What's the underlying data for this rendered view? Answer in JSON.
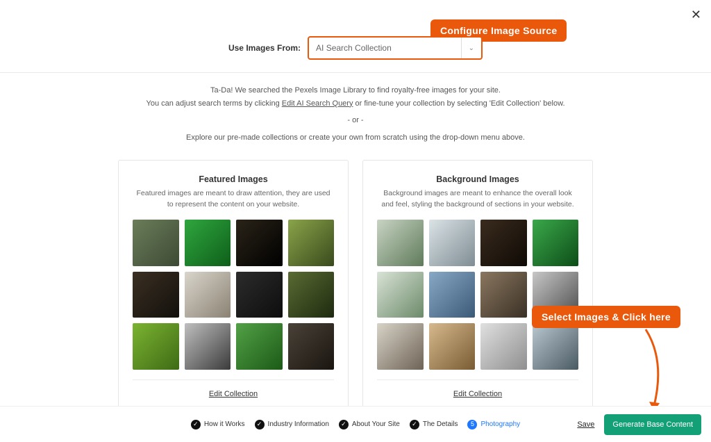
{
  "close_icon": "✕",
  "source": {
    "label": "Use Images From:",
    "selected": "AI Search Collection"
  },
  "callouts": {
    "top": "Configure Image Source",
    "right": "Select Images & Click here"
  },
  "intro": {
    "line1": "Ta-Da! We searched the Pexels Image Library to find royalty-free images for your site.",
    "line2_pre": "You can adjust search terms by clicking ",
    "line2_link": "Edit AI Search Query",
    "line2_post": " or fine-tune your collection by selecting 'Edit Collection' below.",
    "or": "- or -",
    "line3": "Explore our pre-made collections or create your own from scratch using the drop-down menu above."
  },
  "featured": {
    "title": "Featured Images",
    "desc": "Featured images are meant to draw attention, they are used to represent the content on your website.",
    "edit": "Edit Collection",
    "thumbs": [
      {
        "name": "bird-branch",
        "bg": "linear-gradient(135deg,#6b7d5a,#3d4a34)"
      },
      {
        "name": "leaf-macro",
        "bg": "linear-gradient(135deg,#2fa63e,#0e5f1a)"
      },
      {
        "name": "dark-woods",
        "bg": "linear-gradient(135deg,#2a2318,#000)"
      },
      {
        "name": "moss-log",
        "bg": "linear-gradient(135deg,#8aa44a,#394a1c)"
      },
      {
        "name": "fox-night",
        "bg": "linear-gradient(135deg,#3b2f22,#12100c)"
      },
      {
        "name": "hand-camera",
        "bg": "linear-gradient(135deg,#d9d5cc,#8b8273)"
      },
      {
        "name": "laptop-desk",
        "bg": "linear-gradient(135deg,#2c2c2c,#0d0d0d)"
      },
      {
        "name": "camera-grass",
        "bg": "linear-gradient(135deg,#5a6b32,#1e2a10)"
      },
      {
        "name": "caterpillar",
        "bg": "linear-gradient(135deg,#7bb431,#3e6a15)"
      },
      {
        "name": "camera-bw",
        "bg": "linear-gradient(135deg,#bfbfbf,#3b3b3b)"
      },
      {
        "name": "green-plant",
        "bg": "linear-gradient(135deg,#52a146,#1c5a17)"
      },
      {
        "name": "dslr-hold",
        "bg": "linear-gradient(135deg,#4a4238,#1a1510)"
      }
    ]
  },
  "background": {
    "title": "Background Images",
    "desc": "Background images are meant to enhance the overall look and feel, styling the background of sections in your website.",
    "edit": "Edit Collection",
    "thumbs": [
      {
        "name": "photog-outdoor",
        "bg": "linear-gradient(135deg,#c8d4c3,#5f7a5a)"
      },
      {
        "name": "photog-look",
        "bg": "linear-gradient(135deg,#dbe3e6,#7f8d94)"
      },
      {
        "name": "cattle-dark",
        "bg": "linear-gradient(135deg,#3a2b1e,#0f0a05)"
      },
      {
        "name": "fern-green",
        "bg": "linear-gradient(135deg,#3aa84a,#0d4d18)"
      },
      {
        "name": "stork-water",
        "bg": "linear-gradient(135deg,#d9e3d6,#6c8a6a)"
      },
      {
        "name": "boy-camera",
        "bg": "linear-gradient(135deg,#88a9c6,#3b5a78)"
      },
      {
        "name": "man-shoot",
        "bg": "linear-gradient(135deg,#8a7760,#3a3025)"
      },
      {
        "name": "hikers-bw",
        "bg": "linear-gradient(135deg,#c7c7c7,#4d4d4d)"
      },
      {
        "name": "back-shoot",
        "bg": "linear-gradient(135deg,#d8d3c8,#6e6355)"
      },
      {
        "name": "camera-flat",
        "bg": "linear-gradient(135deg,#d6b98c,#7a5c34)"
      },
      {
        "name": "gimbal-hand",
        "bg": "linear-gradient(135deg,#e0e0e0,#8f8f8f)"
      },
      {
        "name": "crow-stump",
        "bg": "linear-gradient(135deg,#bac8d0,#4a5a63)"
      }
    ]
  },
  "steps": [
    {
      "label": "How it Works",
      "done": true
    },
    {
      "label": "Industry Information",
      "done": true
    },
    {
      "label": "About Your Site",
      "done": true
    },
    {
      "label": "The Details",
      "done": true
    },
    {
      "label": "Photography",
      "done": false,
      "current": true,
      "num": "5"
    }
  ],
  "footer": {
    "save": "Save",
    "generate": "Generate Base Content"
  }
}
